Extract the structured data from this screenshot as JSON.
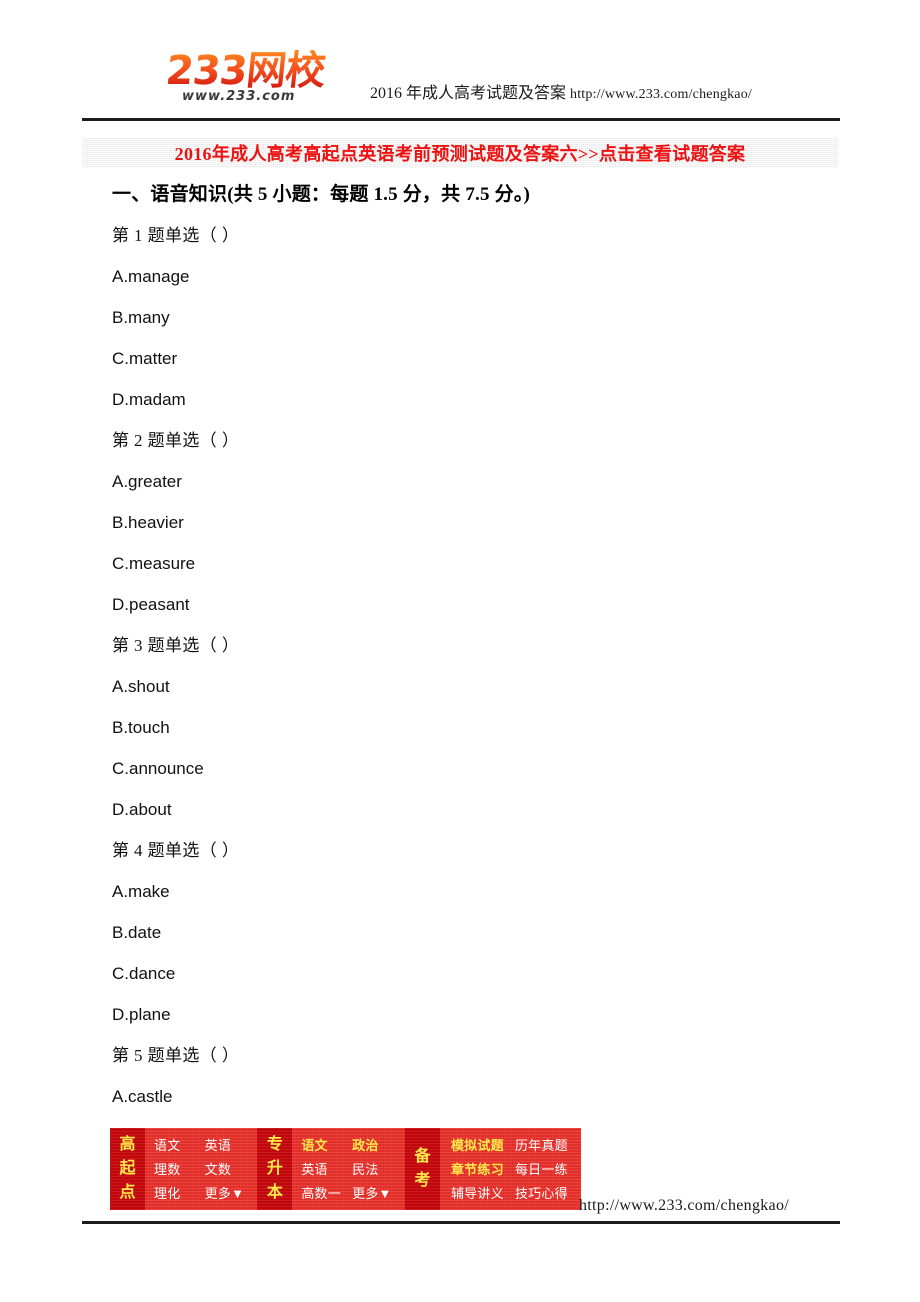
{
  "header": {
    "logo_main": "233网校",
    "logo_sub": "www.233.com",
    "tagline": "2016 年成人高考试题及答案 ",
    "tagline_url": "http://www.233.com/chengkao/"
  },
  "title_bar": {
    "title": "2016年成人高考高起点英语考前预测试题及答案六>>点击查看试题答案",
    "color": "#ee1111",
    "background": "#e9e9e9"
  },
  "content": {
    "section_heading": "一、语音知识(共 5 小题：每题 1.5 分，共 7.5 分。)",
    "questions": [
      {
        "stem": "第 1 题单选（ ）",
        "options": [
          "A.manage",
          "B.many",
          "C.matter",
          "D.madam"
        ]
      },
      {
        "stem": "第 2 题单选（ ）",
        "options": [
          "A.greater",
          "B.heavier",
          "C.measure",
          "D.peasant"
        ]
      },
      {
        "stem": "第 3 题单选（ ）",
        "options": [
          "A.shout",
          "B.touch",
          "C.announce",
          "D.about"
        ]
      },
      {
        "stem": "第 4 题单选（ ）",
        "options": [
          "A.make",
          "B.date",
          "C.dance",
          "D.plane"
        ]
      },
      {
        "stem": "第 5 题单选（ ）",
        "options": [
          "A.castle"
        ]
      }
    ]
  },
  "promo_banner": {
    "background": "#e8302a",
    "label_background": "#c1070c",
    "accent_color": "#ffe94a",
    "groups": [
      {
        "label": "高起点",
        "label_chars": [
          "高",
          "起",
          "点"
        ],
        "items": [
          {
            "text": "语文",
            "highlight": false
          },
          {
            "text": "英语",
            "highlight": false
          },
          {
            "text": "理数",
            "highlight": false
          },
          {
            "text": "文数",
            "highlight": false
          },
          {
            "text": "理化",
            "highlight": false
          },
          {
            "text": "更多▼",
            "highlight": false
          }
        ]
      },
      {
        "label": "专升本",
        "label_chars": [
          "专",
          "升",
          "本"
        ],
        "items": [
          {
            "text": "语文",
            "highlight": true
          },
          {
            "text": "政治",
            "highlight": true
          },
          {
            "text": "英语",
            "highlight": false
          },
          {
            "text": "民法",
            "highlight": false
          },
          {
            "text": "高数一",
            "highlight": false
          },
          {
            "text": "更多▼",
            "highlight": false
          }
        ]
      },
      {
        "label": "备考",
        "label_chars": [
          "备",
          "考"
        ],
        "items": [
          {
            "text": "模拟试题",
            "highlight": true
          },
          {
            "text": "历年真题",
            "highlight": false
          },
          {
            "text": "章节练习",
            "highlight": true
          },
          {
            "text": "每日一练",
            "highlight": false
          },
          {
            "text": "辅导讲义",
            "highlight": false
          },
          {
            "text": "技巧心得",
            "highlight": false
          }
        ]
      }
    ]
  },
  "footer": {
    "url": "http://www.233.com/chengkao/"
  }
}
